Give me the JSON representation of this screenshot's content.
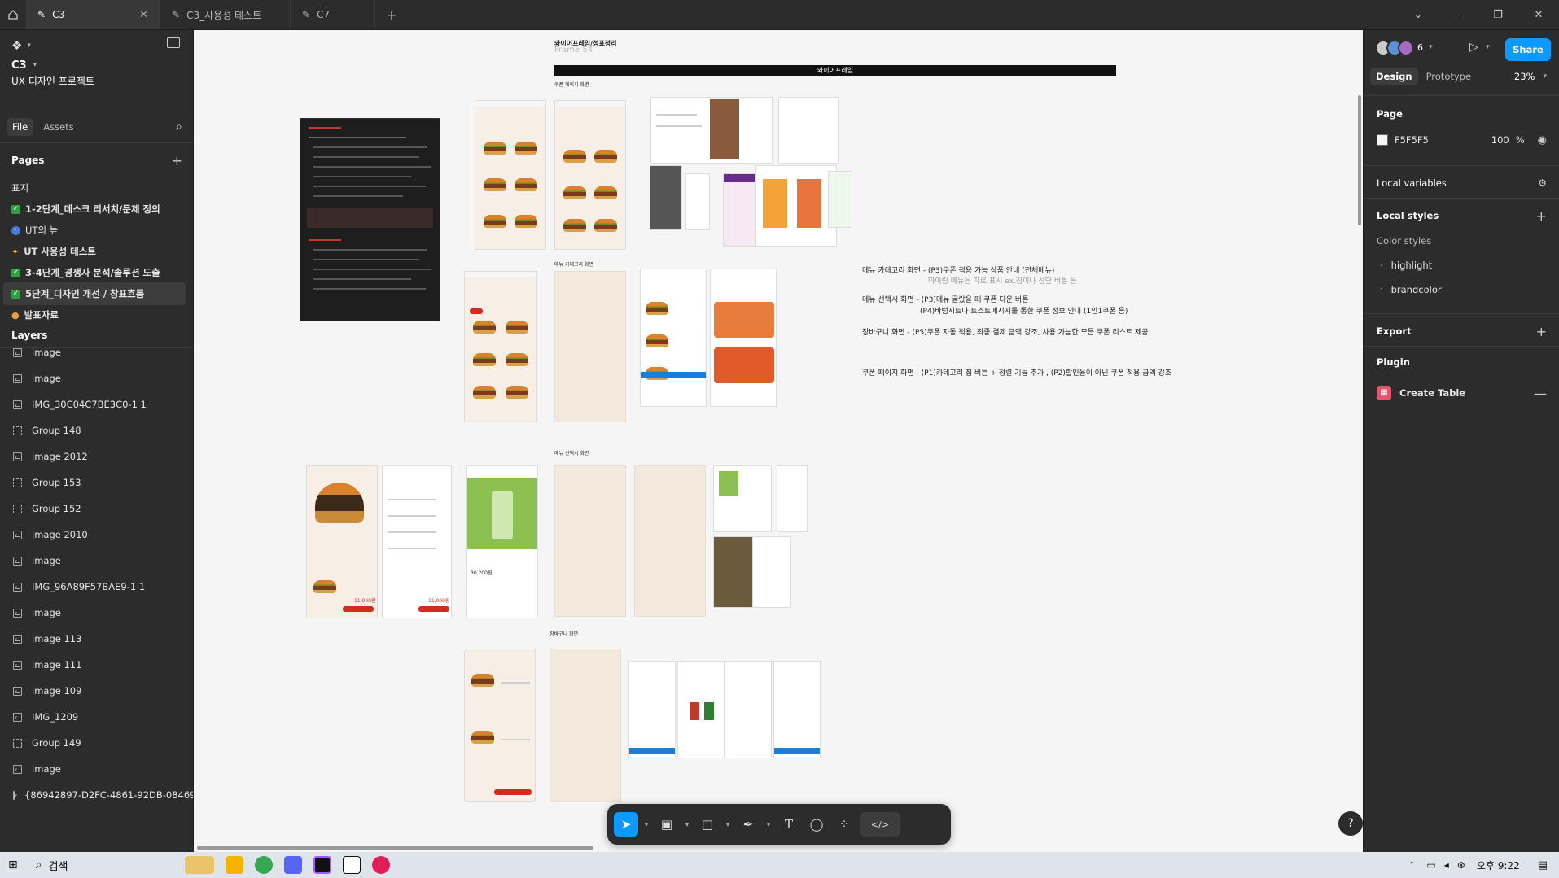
{
  "tabs": [
    {
      "label": "C3"
    },
    {
      "label": "C3_사용성 테스트"
    },
    {
      "label": "C7"
    }
  ],
  "file": {
    "name": "C3",
    "project": "UX 디자인 프로젝트"
  },
  "left_tabs": {
    "file": "File",
    "assets": "Assets"
  },
  "pages": {
    "title": "Pages",
    "items": [
      {
        "label": "표지"
      },
      {
        "label": "1-2단계_데스크 리서치/문제 정의"
      },
      {
        "label": "UT의 늪"
      },
      {
        "label": "UT 사용성 테스트"
      },
      {
        "label": "3-4단계_경쟁사 분석/솔루션 도출"
      },
      {
        "label": "5단계_디자인 개선 / 창표흐름"
      },
      {
        "label": "발표자료"
      }
    ]
  },
  "layers": {
    "title": "Layers",
    "items": [
      {
        "label": "image",
        "icon": "image-icon"
      },
      {
        "label": "image",
        "icon": "image-icon"
      },
      {
        "label": "IMG_30C04C7BE3C0-1 1",
        "icon": "image-icon"
      },
      {
        "label": "Group 148",
        "icon": "frame-icon"
      },
      {
        "label": "image 2012",
        "icon": "image-icon"
      },
      {
        "label": "Group 153",
        "icon": "frame-icon"
      },
      {
        "label": "Group 152",
        "icon": "frame-icon"
      },
      {
        "label": "image 2010",
        "icon": "image-icon"
      },
      {
        "label": "image",
        "icon": "image-icon"
      },
      {
        "label": "IMG_96A89F57BAE9-1 1",
        "icon": "image-icon"
      },
      {
        "label": "image",
        "icon": "image-icon"
      },
      {
        "label": "image 113",
        "icon": "image-icon"
      },
      {
        "label": "image 111",
        "icon": "image-icon"
      },
      {
        "label": "image 109",
        "icon": "image-icon"
      },
      {
        "label": "IMG_1209",
        "icon": "image-icon"
      },
      {
        "label": "Group 149",
        "icon": "frame-icon"
      },
      {
        "label": "image",
        "icon": "image-icon"
      },
      {
        "label": "{86942897-D2FC-4861-92DB-08469",
        "icon": "image-icon"
      }
    ]
  },
  "canvas": {
    "background": "#F5F5F5",
    "frame_title": "와이어프레임/정표정리",
    "frame_subtitle": "Frame 54",
    "black_bar_label": "와이어프레임",
    "section_notes": [
      "쿠폰 페이지 화면",
      "메뉴 카테고리 화면",
      "메뉴 선택시 화면",
      "장바구니 화면"
    ],
    "annotations": [
      {
        "text": "메뉴 카테고리 화면 - (P3)쿠폰 적용 가능 상품 안내 (전체메뉴)"
      },
      {
        "text": "마이링 메뉴는 따로 표시 ex.칩이나 상단 버튼 등"
      },
      {
        "text": "메뉴 선택시 화면 - (P3)메뉴 골랐을 때 쿠폰 다운 버튼"
      },
      {
        "text": "(P4)바텀시트나 토스트메시지를 통한 쿠폰 정보 안내 (1인1쿠폰 등)"
      },
      {
        "text": "장바구니 화면 - (P5)쿠폰 자동 적용, 최종 결제 금액 강조, 사용 가능한 모든 쿠폰 리스트 제공"
      },
      {
        "text": "쿠폰 페이지 화면 - (P1)카테고리 칩 버튼 + 정렬 기능 추가 , (P2)할인율이 아닌 쿠폰 적용 금액 강조"
      }
    ],
    "price_a": "11,000원",
    "price_b": "11,000원",
    "price_c": "30,200원"
  },
  "toolbar": {
    "tools": [
      "move-tool",
      "frame-tool",
      "shape-tool",
      "pen-tool",
      "text-tool",
      "comment-tool",
      "actions-tool",
      "dev-mode-tool"
    ]
  },
  "right": {
    "avatars_count": "6",
    "share_label": "Share",
    "tab_design": "Design",
    "tab_prototype": "Prototype",
    "zoom": "23%",
    "page_section": "Page",
    "page_color_hex": "F5F5F5",
    "page_opacity": "100",
    "page_opacity_unit": "%",
    "local_variables": "Local variables",
    "local_styles": "Local styles",
    "color_styles": "Color styles",
    "style_items": [
      "highlight",
      "brandcolor"
    ],
    "export": "Export",
    "plugin": "Plugin",
    "plugin_item": "Create Table",
    "accent_color": "#0D99FF"
  },
  "taskbar": {
    "search_label": "검색",
    "time": "오후 9:22"
  }
}
